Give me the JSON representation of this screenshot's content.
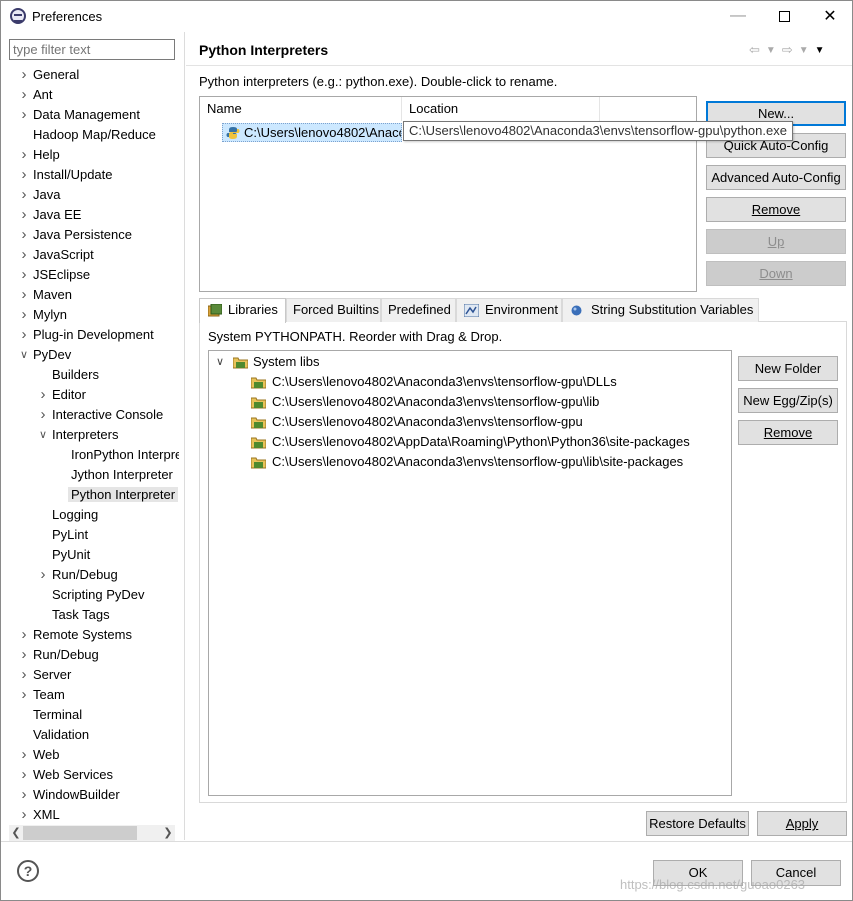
{
  "window": {
    "title": "Preferences"
  },
  "filter": {
    "placeholder": "type filter text"
  },
  "nav": [
    {
      "label": "General",
      "level": 0,
      "twisty": "collapsed"
    },
    {
      "label": "Ant",
      "level": 0,
      "twisty": "collapsed"
    },
    {
      "label": "Data Management",
      "level": 0,
      "twisty": "collapsed"
    },
    {
      "label": "Hadoop Map/Reduce",
      "level": 0,
      "twisty": "none"
    },
    {
      "label": "Help",
      "level": 0,
      "twisty": "collapsed"
    },
    {
      "label": "Install/Update",
      "level": 0,
      "twisty": "collapsed"
    },
    {
      "label": "Java",
      "level": 0,
      "twisty": "collapsed"
    },
    {
      "label": "Java EE",
      "level": 0,
      "twisty": "collapsed"
    },
    {
      "label": "Java Persistence",
      "level": 0,
      "twisty": "collapsed"
    },
    {
      "label": "JavaScript",
      "level": 0,
      "twisty": "collapsed"
    },
    {
      "label": "JSEclipse",
      "level": 0,
      "twisty": "collapsed"
    },
    {
      "label": "Maven",
      "level": 0,
      "twisty": "collapsed"
    },
    {
      "label": "Mylyn",
      "level": 0,
      "twisty": "collapsed"
    },
    {
      "label": "Plug-in Development",
      "level": 0,
      "twisty": "collapsed"
    },
    {
      "label": "PyDev",
      "level": 0,
      "twisty": "expanded"
    },
    {
      "label": "Builders",
      "level": 1,
      "twisty": "none"
    },
    {
      "label": "Editor",
      "level": 1,
      "twisty": "collapsed"
    },
    {
      "label": "Interactive Console",
      "level": 1,
      "twisty": "collapsed"
    },
    {
      "label": "Interpreters",
      "level": 1,
      "twisty": "expanded"
    },
    {
      "label": "IronPython Interpreter",
      "level": 2,
      "twisty": "none"
    },
    {
      "label": "Jython Interpreter",
      "level": 2,
      "twisty": "none"
    },
    {
      "label": "Python Interpreter",
      "level": 2,
      "twisty": "none",
      "selected": true
    },
    {
      "label": "Logging",
      "level": 1,
      "twisty": "none"
    },
    {
      "label": "PyLint",
      "level": 1,
      "twisty": "none"
    },
    {
      "label": "PyUnit",
      "level": 1,
      "twisty": "none"
    },
    {
      "label": "Run/Debug",
      "level": 1,
      "twisty": "collapsed"
    },
    {
      "label": "Scripting PyDev",
      "level": 1,
      "twisty": "none"
    },
    {
      "label": "Task Tags",
      "level": 1,
      "twisty": "none"
    },
    {
      "label": "Remote Systems",
      "level": 0,
      "twisty": "collapsed"
    },
    {
      "label": "Run/Debug",
      "level": 0,
      "twisty": "collapsed"
    },
    {
      "label": "Server",
      "level": 0,
      "twisty": "collapsed"
    },
    {
      "label": "Team",
      "level": 0,
      "twisty": "collapsed"
    },
    {
      "label": "Terminal",
      "level": 0,
      "twisty": "none"
    },
    {
      "label": "Validation",
      "level": 0,
      "twisty": "none"
    },
    {
      "label": "Web",
      "level": 0,
      "twisty": "collapsed"
    },
    {
      "label": "Web Services",
      "level": 0,
      "twisty": "collapsed"
    },
    {
      "label": "WindowBuilder",
      "level": 0,
      "twisty": "collapsed"
    },
    {
      "label": "XML",
      "level": 0,
      "twisty": "collapsed"
    }
  ],
  "page": {
    "title": "Python Interpreters",
    "description": "Python interpreters (e.g.: python.exe).   Double-click to rename."
  },
  "interpreters": {
    "columns": [
      "Name",
      "Location"
    ],
    "rows": [
      {
        "name": "C:\\Users\\lenovo4802\\Anaco",
        "location": "C:\\Users\\lenovo4802\\Anaconda3\\envs\\tensorflow-gpu\\python.exe"
      }
    ],
    "tooltip": "C:\\Users\\lenovo4802\\Anaconda3\\envs\\tensorflow-gpu\\python.exe"
  },
  "interp_buttons": {
    "new": "New...",
    "quick": "Quick Auto-Config",
    "advanced": "Advanced Auto-Config",
    "remove": "Remove",
    "up": "Up",
    "down": "Down"
  },
  "tabs": [
    "Libraries",
    "Forced Builtins",
    "Predefined",
    "Environment",
    "String Substitution Variables"
  ],
  "libraries": {
    "label": "System PYTHONPATH.   Reorder with Drag & Drop.",
    "root": "System libs",
    "paths": [
      "C:\\Users\\lenovo4802\\Anaconda3\\envs\\tensorflow-gpu\\DLLs",
      "C:\\Users\\lenovo4802\\Anaconda3\\envs\\tensorflow-gpu\\lib",
      "C:\\Users\\lenovo4802\\Anaconda3\\envs\\tensorflow-gpu",
      "C:\\Users\\lenovo4802\\AppData\\Roaming\\Python\\Python36\\site-packages",
      "C:\\Users\\lenovo4802\\Anaconda3\\envs\\tensorflow-gpu\\lib\\site-packages"
    ]
  },
  "lib_buttons": {
    "new_folder": "New Folder",
    "new_egg": "New Egg/Zip(s)",
    "remove": "Remove"
  },
  "footer": {
    "restore": "Restore Defaults",
    "apply": "Apply",
    "ok": "OK",
    "cancel": "Cancel",
    "watermark": "https://blog.csdn.net/guoao0263"
  }
}
